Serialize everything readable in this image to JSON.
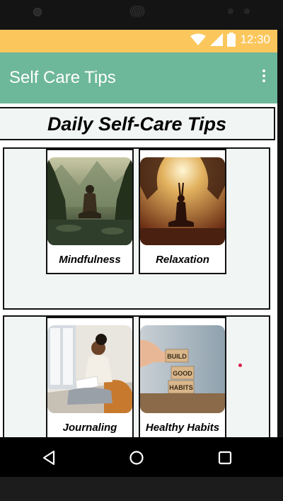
{
  "status_bar": {
    "time": "12:30",
    "icons": [
      "wifi-icon",
      "signal-icon",
      "battery-icon"
    ],
    "color": "#fbc75c"
  },
  "app_bar": {
    "title": "Self Care Tips",
    "menu_icon": "overflow-menu-icon",
    "color": "#6db79a"
  },
  "page": {
    "heading": "Daily Self-Care Tips"
  },
  "tips": [
    {
      "label": "Mindfulness"
    },
    {
      "label": "Relaxation"
    },
    {
      "label": "Journaling"
    },
    {
      "label": "Healthy Habits"
    }
  ],
  "images": {
    "healthy_habits_blocks": [
      "BUILD",
      "GOOD",
      "HABITS"
    ]
  },
  "nav": {
    "icons": [
      "back-icon",
      "home-icon",
      "recents-icon"
    ]
  }
}
